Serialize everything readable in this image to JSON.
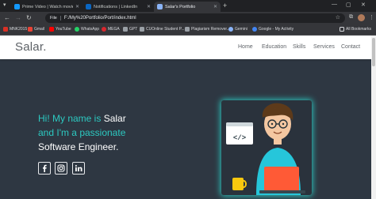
{
  "browser": {
    "tabs": [
      {
        "title": "Prime Video | Watch movies, T..."
      },
      {
        "title": "Notifications | LinkedIn"
      },
      {
        "title": "Salar's Portfolio"
      }
    ],
    "address": {
      "info_label": "File",
      "url": "F:/My%20Portfolio/Port/index.html"
    },
    "bookmarks": [
      {
        "label": "MNK2015",
        "color": "#d93025"
      },
      {
        "label": "Gmail",
        "color": "#ea4335"
      },
      {
        "label": "YouTube",
        "color": "#ff0000"
      },
      {
        "label": "WhatsApp",
        "color": "#25d366"
      },
      {
        "label": "MEGA",
        "color": "#d9272e"
      },
      {
        "label": "GPT",
        "color": "#9aa0a6"
      },
      {
        "label": "CUOnline Student P...",
        "color": "#9aa0a6"
      },
      {
        "label": "Plagiarism Remover...",
        "color": "#9aa0a6"
      },
      {
        "label": "Gemini",
        "color": "#8ab4f8"
      },
      {
        "label": "Google - My Activity",
        "color": "#4285f4"
      }
    ],
    "all_bookmarks_label": "All Bookmarks"
  },
  "site": {
    "logo": "Salar.",
    "nav": [
      "Home",
      "Education",
      "Skills",
      "Services",
      "Contact"
    ],
    "hero": {
      "greeting_prefix": "Hi! My name is ",
      "name": "Salar",
      "line2": "and I'm a passionate",
      "line3": "Software Engineer."
    },
    "social": [
      {
        "icon": "facebook-icon"
      },
      {
        "icon": "instagram-icon"
      },
      {
        "icon": "linkedin-icon"
      }
    ],
    "illustration": {
      "code_glyph": "</>"
    }
  },
  "colors": {
    "accent": "#2cc9c1",
    "page_bg": "#2e3742",
    "navbar_bg": "#ffffff",
    "browser_dark": "#202124"
  }
}
